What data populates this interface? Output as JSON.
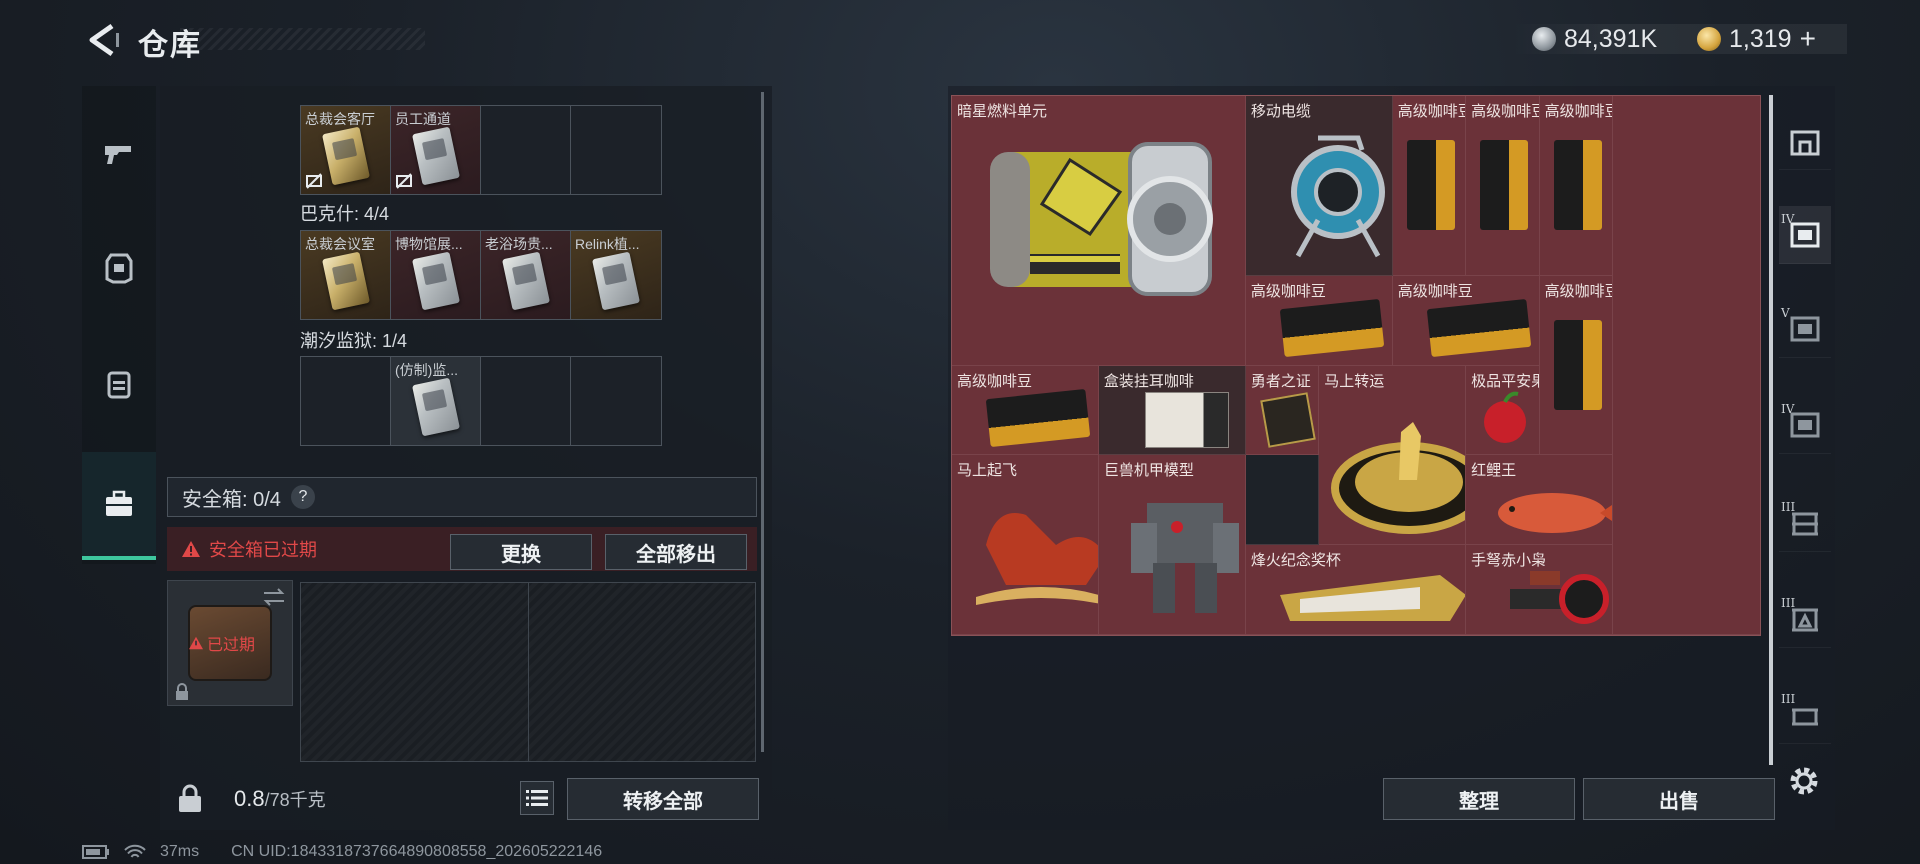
{
  "header": {
    "title": "仓库",
    "currency_silver": "84,391K",
    "currency_gold": "1,319",
    "plus": "+"
  },
  "containers": {
    "group_top": {
      "items": [
        {
          "name": "总裁会客厅"
        },
        {
          "name": "员工通道"
        }
      ]
    },
    "group_bakesh": {
      "label": "巴克什: 4/4",
      "items": [
        {
          "name": "总裁会议室"
        },
        {
          "name": "博物馆展..."
        },
        {
          "name": "老浴场贵..."
        },
        {
          "name": "Relink植..."
        }
      ]
    },
    "group_prison": {
      "label": "潮汐监狱: 1/4",
      "items": [
        {
          "name": "(仿制)监..."
        }
      ]
    }
  },
  "safe": {
    "label": "安全箱: 0/4",
    "help": "?",
    "expired_notice": "安全箱已过期",
    "replace_button": "更换",
    "remove_all_button": "全部移出",
    "case_badge": "已过期"
  },
  "bottom_left": {
    "weight_value": "0.8",
    "weight_total": "/78千克",
    "transfer_all_button": "转移全部"
  },
  "status": {
    "ping": "37ms",
    "uid": "CN UID:1843318737664890808558_202605222146"
  },
  "storage": {
    "items": [
      {
        "name": "暗星燃料单元"
      },
      {
        "name": "移动电缆"
      },
      {
        "name": "高级咖啡豆"
      },
      {
        "name": "高级咖啡豆"
      },
      {
        "name": "高级咖啡豆"
      },
      {
        "name": "高级咖啡豆"
      },
      {
        "name": "高级咖啡豆"
      },
      {
        "name": "高级咖啡豆"
      },
      {
        "name": "高级咖啡豆"
      },
      {
        "name": "盒装挂耳咖啡"
      },
      {
        "name": "勇者之证"
      },
      {
        "name": "马上转运"
      },
      {
        "name": "极品平安果"
      },
      {
        "name": "马上起飞"
      },
      {
        "name": "巨兽机甲模型"
      },
      {
        "name": "红鲤王"
      },
      {
        "name": "烽火纪念奖杯"
      },
      {
        "name": "手弩赤小枭"
      }
    ],
    "sort_button": "整理",
    "sell_button": "出售"
  },
  "right_tabs": [
    {
      "tier": ""
    },
    {
      "tier": "IV"
    },
    {
      "tier": "V"
    },
    {
      "tier": "IV"
    },
    {
      "tier": "III"
    },
    {
      "tier": "III"
    },
    {
      "tier": "III"
    }
  ],
  "colors": {
    "accent_green": "#3ec79e",
    "storage_grid": "#6b3239",
    "warning_red": "#e04848"
  },
  "icons": {
    "back": "arrow-left-icon",
    "silver_coin": "silver-coin-icon",
    "gold_coin": "gold-coin-icon",
    "settings": "gear-icon"
  }
}
